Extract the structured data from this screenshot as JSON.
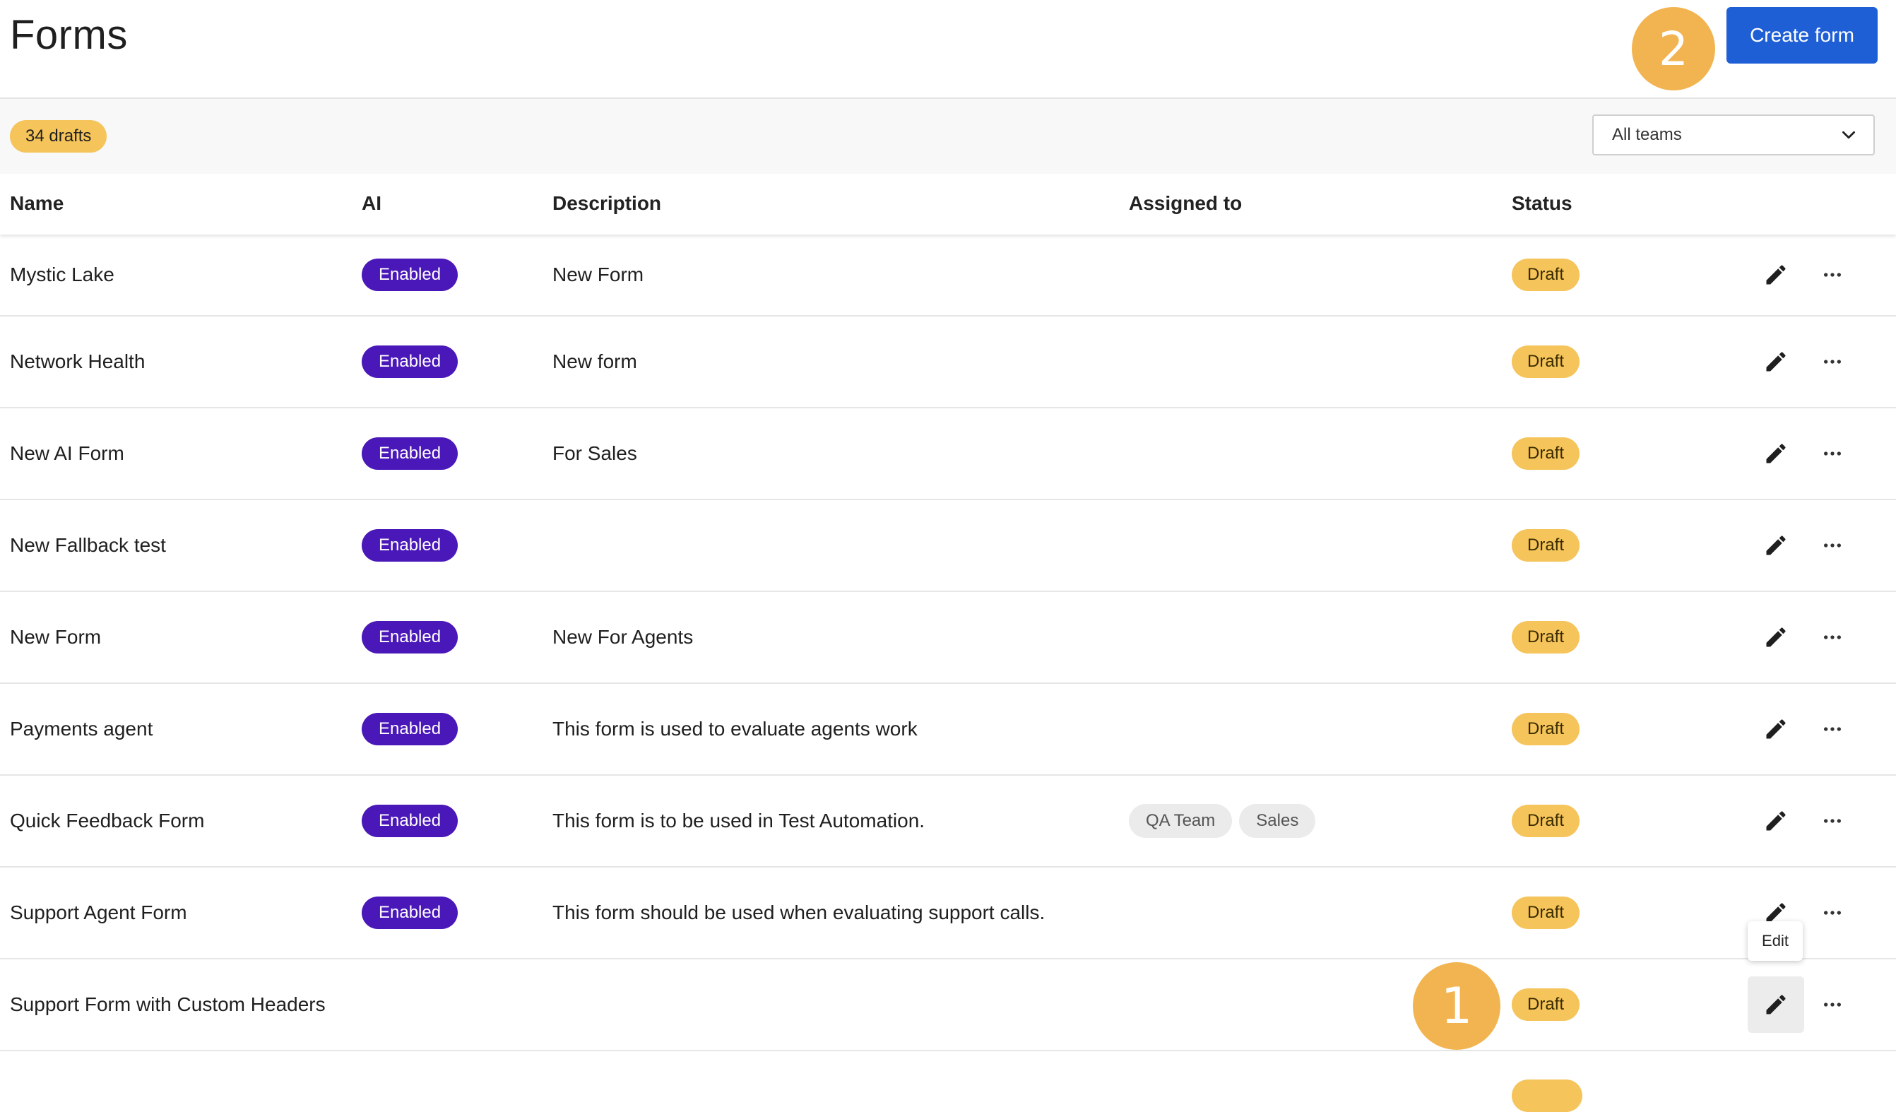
{
  "page": {
    "title": "Forms",
    "create_button": "Create form",
    "step_badges": {
      "create": "2",
      "edit": "1"
    }
  },
  "toolbar": {
    "drafts_count": "34 drafts",
    "team_filter": "All teams"
  },
  "table": {
    "columns": [
      "Name",
      "AI",
      "Description",
      "Assigned to",
      "Status"
    ],
    "rows": [
      {
        "name": "Mystic Lake",
        "ai": "Enabled",
        "description": "New Form",
        "assigned": [],
        "status": "Draft"
      },
      {
        "name": "Network Health",
        "ai": "Enabled",
        "description": "New form",
        "assigned": [],
        "status": "Draft"
      },
      {
        "name": "New AI Form",
        "ai": "Enabled",
        "description": "For Sales",
        "assigned": [],
        "status": "Draft"
      },
      {
        "name": "New Fallback test",
        "ai": "Enabled",
        "description": "",
        "assigned": [],
        "status": "Draft"
      },
      {
        "name": "New Form",
        "ai": "Enabled",
        "description": "New For Agents",
        "assigned": [],
        "status": "Draft"
      },
      {
        "name": "Payments agent",
        "ai": "Enabled",
        "description": "This form is used to evaluate agents work",
        "assigned": [],
        "status": "Draft"
      },
      {
        "name": "Quick Feedback Form",
        "ai": "Enabled",
        "description": "This form is to be used in Test Automation.",
        "assigned": [
          "QA Team",
          "Sales"
        ],
        "status": "Draft"
      },
      {
        "name": "Support Agent Form",
        "ai": "Enabled",
        "description": "This form should be used when evaluating support calls.",
        "assigned": [],
        "status": "Draft"
      },
      {
        "name": "Support Form with Custom Headers",
        "ai": "",
        "description": "",
        "assigned": [],
        "status": "Draft"
      }
    ]
  },
  "tooltip": {
    "edit": "Edit"
  },
  "icons": {
    "edit": "pencil-icon",
    "more": "more-horizontal-icon",
    "dropdown": "chevron-down-icon"
  },
  "colors": {
    "accent": "#1f5fd6",
    "ai_enabled": "#4a17b8",
    "draft": "#f5c45a",
    "step_badge": "#f2b450"
  }
}
